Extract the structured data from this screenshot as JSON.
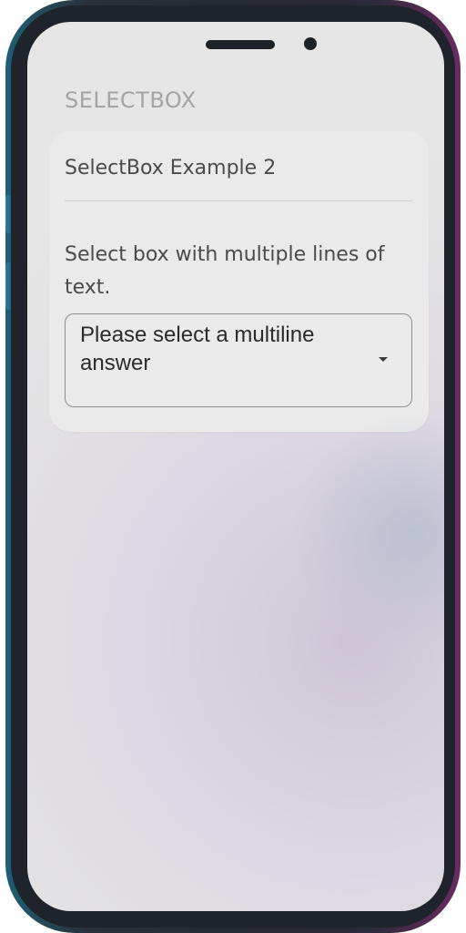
{
  "section": {
    "title": "SELECTBOX"
  },
  "card": {
    "title": "SelectBox Example 2",
    "description": "Select box with multiple lines of text.",
    "select": {
      "value": "Please select a multiline answer",
      "caret_icon": "caret-down-icon"
    }
  },
  "colors": {
    "screen_bg": "#e6e6e6",
    "card_bg": "#eaeaea",
    "title_text": "#a4a4a4",
    "body_text": "#4a4a4a",
    "frame_dark": "#1f232b",
    "frame_teal": "#1f5f74",
    "frame_magenta": "#6a2b61"
  }
}
